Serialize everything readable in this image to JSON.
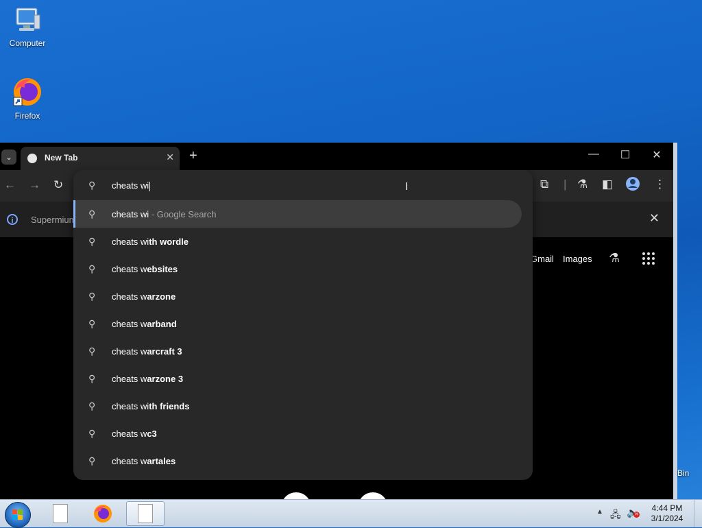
{
  "desktop": {
    "icons": [
      {
        "label": "Computer",
        "icon": "computer-icon"
      },
      {
        "label": "Firefox",
        "icon": "firefox-icon"
      }
    ],
    "recycle_bin_partial_label": "Bin"
  },
  "browser": {
    "tab": {
      "title": "New Tab"
    },
    "infobar": {
      "text": "Supermium"
    },
    "ntp_links": {
      "gmail": "Gmail",
      "images": "Images"
    }
  },
  "omnibox": {
    "input_value": "cheats wi",
    "suggestions": [
      {
        "typed": "cheats wi",
        "completion": "",
        "desc": " - Google Search"
      },
      {
        "typed": "cheats wi",
        "completion": "th wordle",
        "desc": ""
      },
      {
        "typed": "cheats w",
        "completion": "ebsites",
        "desc": ""
      },
      {
        "typed": "cheats w",
        "completion": "arzone",
        "desc": ""
      },
      {
        "typed": "cheats w",
        "completion": "arband",
        "desc": ""
      },
      {
        "typed": "cheats w",
        "completion": "arcraft 3",
        "desc": ""
      },
      {
        "typed": "cheats w",
        "completion": "arzone 3",
        "desc": ""
      },
      {
        "typed": "cheats wi",
        "completion": "th friends",
        "desc": ""
      },
      {
        "typed": "cheats w",
        "completion": "c3",
        "desc": ""
      },
      {
        "typed": "cheats w",
        "completion": "artales",
        "desc": ""
      }
    ]
  },
  "taskbar": {
    "clock_time": "4:44 PM",
    "clock_date": "3/1/2024"
  },
  "colors": {
    "accent": "#8ab4f8",
    "dropdown_bg": "#282828",
    "selected_row": "#3d3d3d"
  }
}
